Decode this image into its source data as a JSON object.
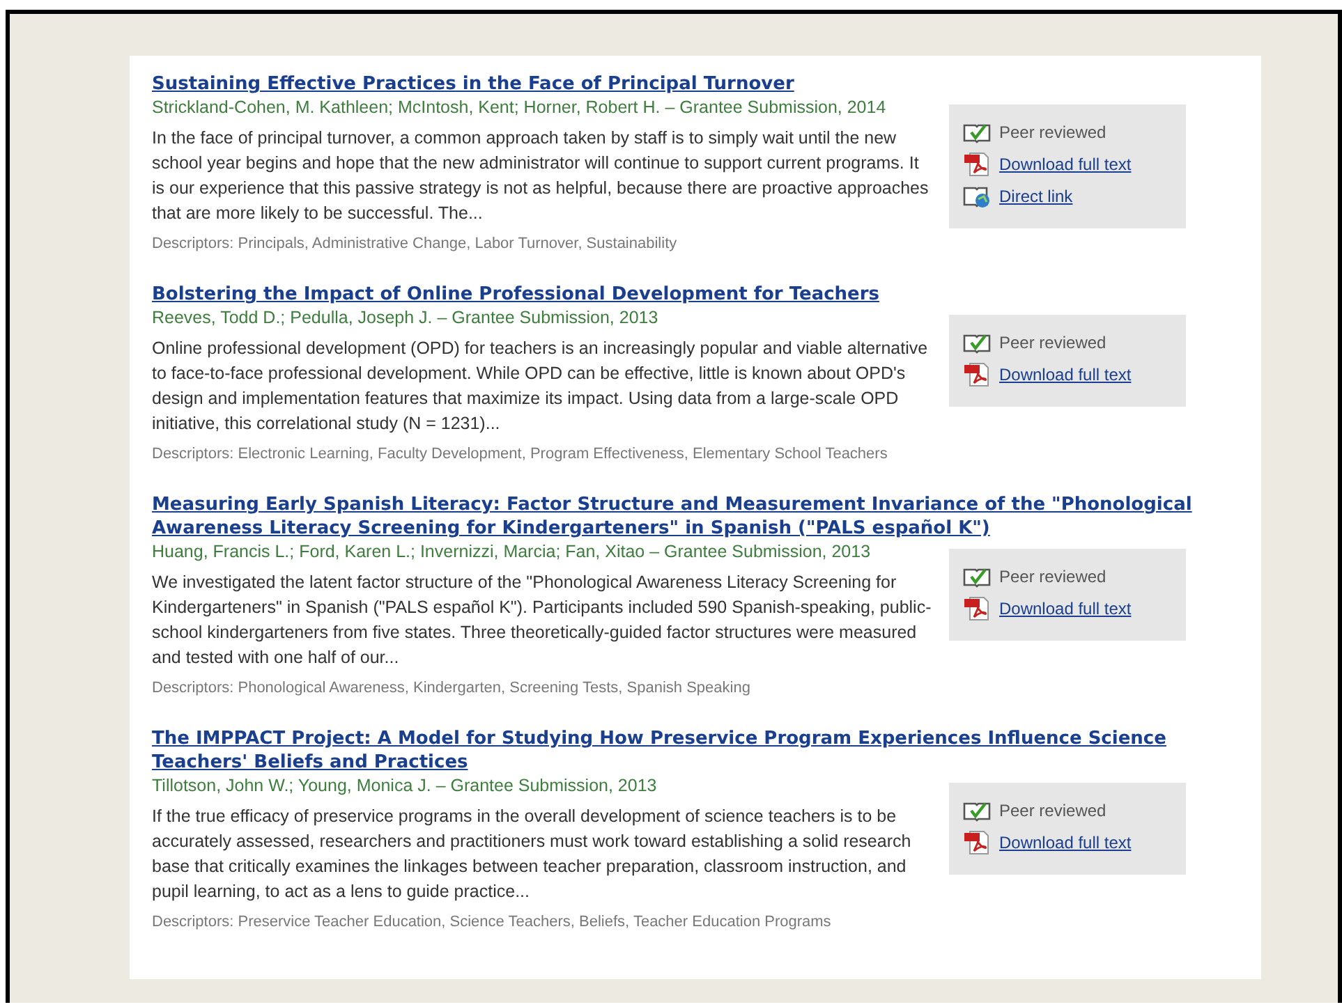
{
  "results": [
    {
      "title": "Sustaining Effective Practices in the Face of Principal Turnover",
      "authors": "Strickland-Cohen, M. Kathleen; McIntosh, Kent; Horner, Robert H. – Grantee Submission, 2014",
      "abstract": "In the face of principal turnover, a common approach taken by staff is to simply wait until the new school year begins and hope that the new administrator will continue to support current programs. It is our experience that this passive strategy is not as helpful, because there are proactive approaches that are more likely to be successful. The...",
      "descriptors": "Descriptors: Principals, Administrative Change, Labor Turnover, Sustainability",
      "links": [
        {
          "kind": "peer",
          "label": "Peer reviewed"
        },
        {
          "kind": "pdf",
          "label": "Download full text"
        },
        {
          "kind": "direct",
          "label": "Direct link"
        }
      ]
    },
    {
      "title": "Bolstering the Impact of Online Professional Development for Teachers",
      "authors": "Reeves, Todd D.; Pedulla, Joseph J. – Grantee Submission, 2013",
      "abstract": "Online professional development (OPD) for teachers is an increasingly popular and viable alternative to face-to-face professional development. While OPD can be effective, little is known about OPD's design and implementation features that maximize its impact. Using data from a large-scale OPD initiative, this correlational study (N = 1231)...",
      "descriptors": "Descriptors: Electronic Learning, Faculty Development, Program Effectiveness, Elementary School Teachers",
      "links": [
        {
          "kind": "peer",
          "label": "Peer reviewed"
        },
        {
          "kind": "pdf",
          "label": "Download full text"
        }
      ]
    },
    {
      "title": "Measuring Early Spanish Literacy: Factor Structure and Measurement Invariance of the \"Phonological Awareness Literacy Screening for Kindergarteners\" in Spanish (\"PALS español K\")",
      "authors": "Huang, Francis L.; Ford, Karen L.; Invernizzi, Marcia; Fan, Xitao – Grantee Submission, 2013",
      "abstract": "We investigated the latent factor structure of the \"Phonological Awareness Literacy Screening for Kindergarteners\" in Spanish (\"PALS español K\"). Participants included 590 Spanish-speaking, public-school kindergarteners from five states. Three theoretically-guided factor structures were measured and tested with one half of our...",
      "descriptors": "Descriptors: Phonological Awareness, Kindergarten, Screening Tests, Spanish Speaking",
      "links": [
        {
          "kind": "peer",
          "label": "Peer reviewed"
        },
        {
          "kind": "pdf",
          "label": "Download full text"
        }
      ]
    },
    {
      "title": "The IMPPACT Project: A Model for Studying How Preservice Program Experiences Influence Science Teachers' Beliefs and Practices",
      "authors": "Tillotson, John W.; Young, Monica J. – Grantee Submission, 2013",
      "abstract": "If the true efficacy of preservice programs in the overall development of science teachers is to be accurately assessed, researchers and practitioners must work toward establishing a solid research base that critically examines the linkages between teacher preparation, classroom instruction, and pupil learning, to act as a lens to guide practice...",
      "descriptors": "Descriptors: Preservice Teacher Education, Science Teachers, Beliefs, Teacher Education Programs",
      "links": [
        {
          "kind": "peer",
          "label": "Peer reviewed"
        },
        {
          "kind": "pdf",
          "label": "Download full text"
        }
      ]
    }
  ]
}
